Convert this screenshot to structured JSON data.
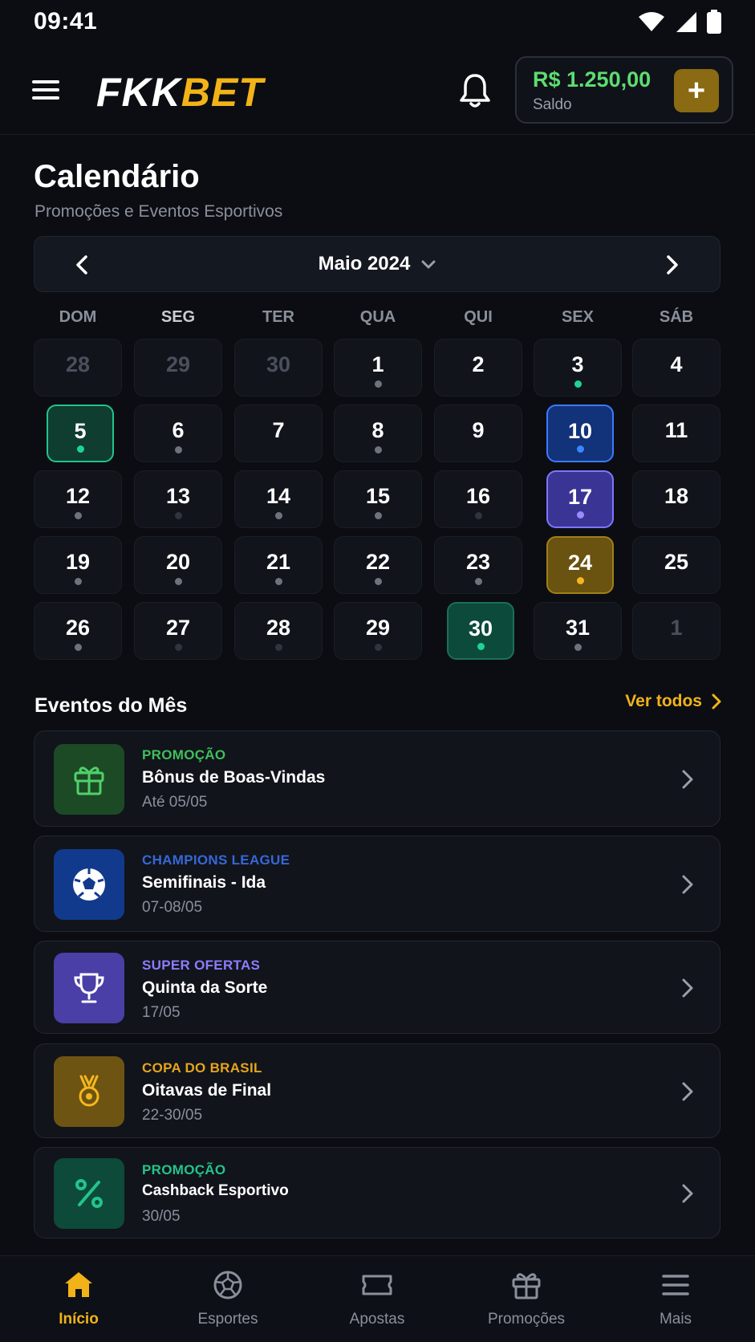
{
  "status": {
    "time": "09:41"
  },
  "header": {
    "logo_primary": "FKK",
    "logo_accent": "BET",
    "balance_amount": "R$ 1.250,00",
    "balance_label": "Saldo",
    "deposit_symbol": "+"
  },
  "page": {
    "title": "Calendário",
    "subtitle": "Promoções e Eventos Esportivos"
  },
  "calendar": {
    "month_label": "Maio 2024",
    "weekdays": [
      "DOM",
      "SEG",
      "TER",
      "QUA",
      "QUI",
      "SEX",
      "SÁB"
    ],
    "weeks": [
      [
        "28",
        "29",
        "30",
        "1",
        "2",
        "3",
        "4"
      ],
      [
        "5",
        "6",
        "7",
        "8",
        "9",
        "10",
        "11"
      ],
      [
        "12",
        "13",
        "14",
        "15",
        "16",
        "17",
        "18"
      ],
      [
        "19",
        "20",
        "21",
        "22",
        "23",
        "24",
        "25"
      ],
      [
        "26",
        "27",
        "28",
        "29",
        "30",
        "31",
        "1"
      ]
    ]
  },
  "events": {
    "title": "Eventos do Mês",
    "see_all": "Ver todos",
    "items": [
      {
        "category": "PROMOÇÃO",
        "name": "Bônus de Boas-Vindas",
        "date": "Até 05/05",
        "icon": "gift-icon",
        "color": "#3fbf5a",
        "bg": "#1c4a25"
      },
      {
        "category": "CHAMPIONS LEAGUE",
        "name": "Semifinais - Ida",
        "date": "07-08/05",
        "icon": "soccer-ball-icon",
        "color": "#3568d8",
        "bg": "#123a8c"
      },
      {
        "category": "SUPER OFERTAS",
        "name": "Quinta da Sorte",
        "date": "17/05",
        "icon": "trophy-icon",
        "color": "#8a7dff",
        "bg": "#4a3fa6"
      },
      {
        "category": "COPA DO BRASIL",
        "name": "Oitavas de Final",
        "date": "22-30/05",
        "icon": "medal-icon",
        "color": "#e5a51d",
        "bg": "#6e5412"
      },
      {
        "category": "PROMOÇÃO",
        "name": "Cashback Esportivo",
        "date": "30/05",
        "icon": "percent-icon",
        "color": "#23c48a",
        "bg": "#0d4a3a"
      }
    ]
  },
  "nav": {
    "items": [
      {
        "label": "Início",
        "icon": "home-icon"
      },
      {
        "label": "Esportes",
        "icon": "soccer-ball-icon"
      },
      {
        "label": "Apostas",
        "icon": "ticket-icon"
      },
      {
        "label": "Promoções",
        "icon": "gift-icon"
      },
      {
        "label": "Mais",
        "icon": "menu-icon"
      }
    ]
  },
  "colors": {
    "accent": "#f2b318",
    "balance": "#5ddc72",
    "background": "#0b0d12"
  }
}
